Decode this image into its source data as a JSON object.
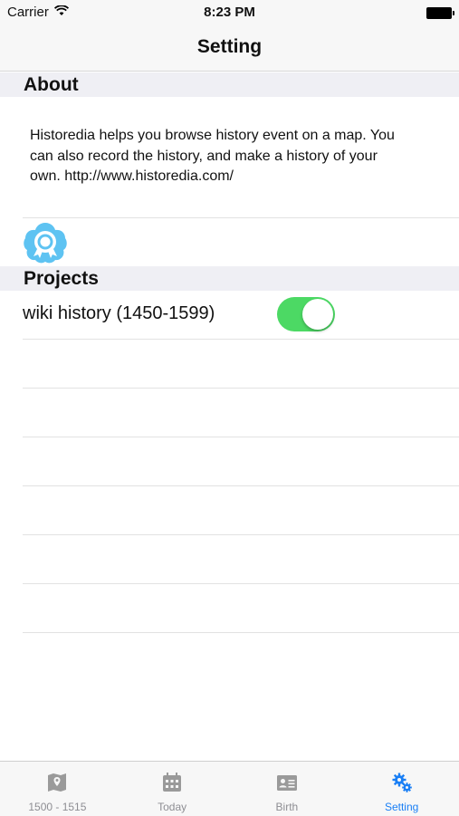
{
  "status_bar": {
    "carrier": "Carrier",
    "time": "8:23 PM"
  },
  "nav": {
    "title": "Setting"
  },
  "about": {
    "header": "About",
    "text": "Historedia helps you browse history event on a map. You can also record the history, and make a history of your own. http://www.historedia.com/",
    "icon": "app-icon"
  },
  "projects": {
    "header": "Projects",
    "items": [
      {
        "label": "wiki history (1450-1599)",
        "enabled": true
      }
    ]
  },
  "tab_bar": {
    "tabs": [
      {
        "label": "1500  - 1515",
        "icon": "map-icon",
        "active": false
      },
      {
        "label": "Today",
        "icon": "calendar-icon",
        "active": false
      },
      {
        "label": "Birth",
        "icon": "id-card-icon",
        "active": false
      },
      {
        "label": "Setting",
        "icon": "gears-icon",
        "active": true
      }
    ]
  },
  "colors": {
    "accent": "#1a7ff5",
    "toggle_on": "#4cd964",
    "section_bg": "#efeff4"
  }
}
